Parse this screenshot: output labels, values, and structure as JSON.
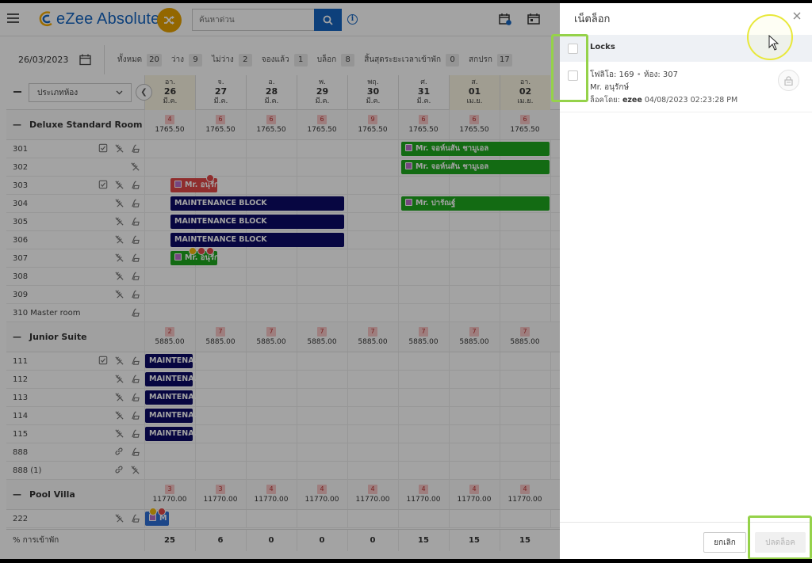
{
  "header": {
    "logo_text": "eZee Absolute",
    "search_placeholder": "ค้นหาด่วน"
  },
  "stats": {
    "date": "26/03/2023",
    "items": [
      {
        "label": "ทั้งหมด",
        "count": "20"
      },
      {
        "label": "ว่าง",
        "count": "9"
      },
      {
        "label": "ไม่ว่าง",
        "count": "2"
      },
      {
        "label": "จองแล้ว",
        "count": "1"
      },
      {
        "label": "บล็อก",
        "count": "8"
      },
      {
        "label": "สิ้นสุดระยะเวลาเข้าพัก",
        "count": "0"
      },
      {
        "label": "สกปรก",
        "count": "17"
      }
    ]
  },
  "grid": {
    "room_type_select": "ประเภทห้อง",
    "days": [
      {
        "dow": "อา.",
        "day": "26",
        "month": "มี.ค.",
        "weekend": true
      },
      {
        "dow": "จ.",
        "day": "27",
        "month": "มี.ค.",
        "weekend": false
      },
      {
        "dow": "อ.",
        "day": "28",
        "month": "มี.ค.",
        "weekend": false
      },
      {
        "dow": "พ.",
        "day": "29",
        "month": "มี.ค.",
        "weekend": false
      },
      {
        "dow": "พฤ.",
        "day": "30",
        "month": "มี.ค.",
        "weekend": false
      },
      {
        "dow": "ศ.",
        "day": "31",
        "month": "มี.ค.",
        "weekend": false
      },
      {
        "dow": "ส.",
        "day": "01",
        "month": "เม.ย.",
        "weekend": true
      },
      {
        "dow": "อา.",
        "day": "02",
        "month": "เม.ย.",
        "weekend": true
      }
    ],
    "groups": [
      {
        "name": "Deluxe Standard Room",
        "avail": [
          "4",
          "6",
          "6",
          "6",
          "9",
          "6",
          "6",
          "6"
        ],
        "price": "1765.50",
        "rooms": [
          {
            "name": "301",
            "icons": [
              "check",
              "broom",
              "hk"
            ]
          },
          {
            "name": "302",
            "icons": [
              "broom"
            ]
          },
          {
            "name": "303",
            "icons": [
              "check",
              "broom",
              "hk"
            ]
          },
          {
            "name": "304",
            "icons": [
              "broom",
              "hk"
            ]
          },
          {
            "name": "305",
            "icons": [
              "broom",
              "hk"
            ]
          },
          {
            "name": "306",
            "icons": [
              "broom",
              "hk"
            ]
          },
          {
            "name": "307",
            "icons": [
              "broom",
              "hk"
            ]
          },
          {
            "name": "308",
            "icons": [
              "broom",
              "hk"
            ]
          },
          {
            "name": "309",
            "icons": [
              "broom",
              "hk"
            ]
          },
          {
            "name": "310 Master room",
            "icons": [
              "hk"
            ]
          }
        ]
      },
      {
        "name": "Junior Suite",
        "avail": [
          "2",
          "7",
          "7",
          "7",
          "7",
          "7",
          "7",
          "7"
        ],
        "price": "5885.00",
        "rooms": [
          {
            "name": "111",
            "icons": [
              "check",
              "broom",
              "hk"
            ]
          },
          {
            "name": "112",
            "icons": [
              "broom",
              "hk"
            ]
          },
          {
            "name": "113",
            "icons": [
              "broom",
              "hk"
            ]
          },
          {
            "name": "114",
            "icons": [
              "broom",
              "hk"
            ]
          },
          {
            "name": "115",
            "icons": [
              "broom",
              "hk"
            ]
          },
          {
            "name": "888",
            "icons": [
              "link",
              "hk"
            ]
          },
          {
            "name": "888 (1)",
            "icons": [
              "link",
              "broom"
            ]
          }
        ]
      },
      {
        "name": "Pool Villa",
        "avail": [
          "3",
          "3",
          "4",
          "4",
          "4",
          "4",
          "4",
          "4"
        ],
        "price": "11770.00",
        "rooms": [
          {
            "name": "222",
            "icons": [
              "broom",
              "hk"
            ]
          }
        ]
      }
    ],
    "bookings": [
      {
        "room": "301",
        "start": 5.05,
        "span": 2.95,
        "color": "green",
        "label": "Mr. จอห์นสัน ชามูเอล",
        "icon": true
      },
      {
        "room": "302",
        "start": 5.05,
        "span": 2.95,
        "color": "green",
        "label": "Mr. จอห์นสัน ชามูเอล",
        "icon": true
      },
      {
        "room": "303",
        "start": 0.5,
        "span": 0.95,
        "color": "red",
        "label": "Mr. อนุรักษ์",
        "icon": true,
        "badges": [
          "red"
        ]
      },
      {
        "room": "304",
        "start": 0.5,
        "span": 3.45,
        "color": "navy",
        "label": "MAINTENANCE BLOCK",
        "icon": false
      },
      {
        "room": "304",
        "start": 5.05,
        "span": 2.95,
        "color": "green",
        "label": "Mr. ปารัณฐ์",
        "icon": true
      },
      {
        "room": "305",
        "start": 0.5,
        "span": 3.45,
        "color": "navy",
        "label": "MAINTENANCE BLOCK",
        "icon": false
      },
      {
        "room": "306",
        "start": 0.5,
        "span": 3.45,
        "color": "navy",
        "label": "MAINTENANCE BLOCK",
        "icon": false
      },
      {
        "room": "307",
        "start": 0.5,
        "span": 0.95,
        "color": "green",
        "label": "Mr. อนุรักษ์",
        "icon": true,
        "badges": [
          "crown",
          "red",
          "red"
        ]
      },
      {
        "room": "111",
        "start": 0.0,
        "span": 0.97,
        "color": "navy",
        "label": "MAINTENA...",
        "icon": false
      },
      {
        "room": "112",
        "start": 0.0,
        "span": 0.97,
        "color": "navy",
        "label": "MAINTENA...",
        "icon": false
      },
      {
        "room": "113",
        "start": 0.0,
        "span": 0.97,
        "color": "navy",
        "label": "MAINTENA...",
        "icon": false
      },
      {
        "room": "114",
        "start": 0.0,
        "span": 0.97,
        "color": "navy",
        "label": "MAINTENA...",
        "icon": false
      },
      {
        "room": "115",
        "start": 0.0,
        "span": 0.97,
        "color": "navy",
        "label": "MAINTENA...",
        "icon": false
      },
      {
        "room": "222",
        "start": 0.0,
        "span": 0.5,
        "color": "blue",
        "label": "M",
        "icon": true,
        "badges": [
          "crown",
          "red"
        ]
      }
    ],
    "footer": {
      "label": "% การเข้าพัก",
      "values": [
        "25",
        "6",
        "0",
        "0",
        "0",
        "15",
        "15",
        "15"
      ]
    }
  },
  "panel": {
    "title": "เน็ตล็อก",
    "locks_header": "Locks",
    "lock_item": {
      "folio_label": "โฟลิโอ:",
      "folio": "169",
      "room_label": "ห้อง:",
      "room": "307",
      "guest": "Mr. อนุรักษ์",
      "locked_by_label": "ล็อคโดย:",
      "locked_by": "ezee",
      "locked_at": "04/08/2023 02:23:28 PM"
    },
    "cancel_label": "ยกเลิก",
    "unlock_label": "ปลดล็อค"
  },
  "colors": {
    "brand_blue": "#1565c0",
    "booking_green": "#1ea81e",
    "booking_navy": "#0c0a66",
    "highlight_green": "#95d24a",
    "cursor_yellow": "#e8e83a"
  }
}
